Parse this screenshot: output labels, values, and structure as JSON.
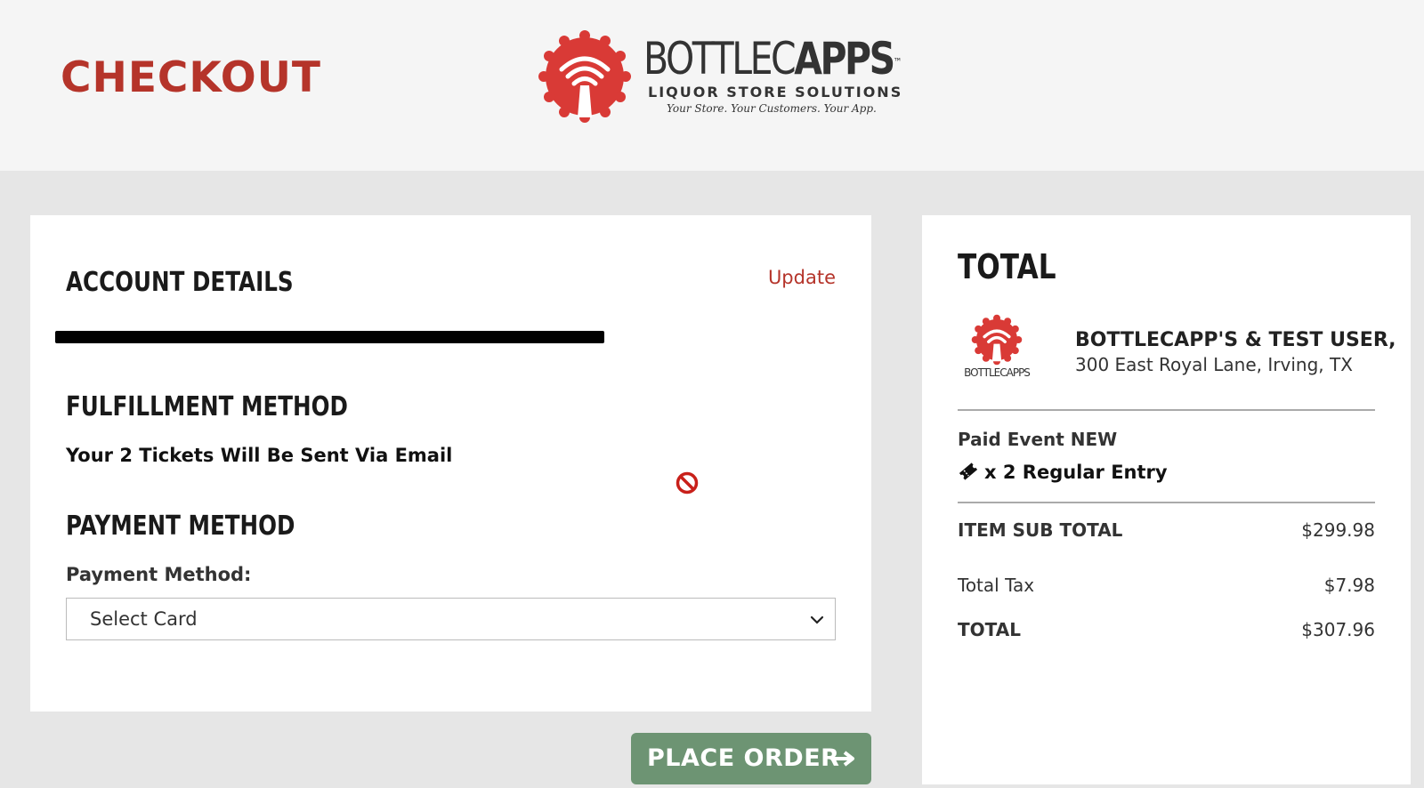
{
  "header": {
    "title": "CHECKOUT",
    "logo": {
      "name_light": "BOTTLEC",
      "name_bold": "APPS",
      "trademark": "™",
      "tagline": "LIQUOR STORE SOLUTIONS",
      "slogan": "Your Store. Your Customers. Your App."
    }
  },
  "account": {
    "title": "ACCOUNT DETAILS",
    "update_label": "Update"
  },
  "fulfillment": {
    "title": "FULFILLMENT METHOD",
    "text": "Your 2 Tickets Will Be Sent Via Email"
  },
  "payment": {
    "title": "PAYMENT METHOD",
    "label": "Payment Method:",
    "selected": "Select Card"
  },
  "place_order": {
    "label": "PLACE ORDER"
  },
  "summary": {
    "title": "TOTAL",
    "store_logo_text": "BOTTLECAPPS",
    "store_name": "BOTTLECAPP'S & TEST USER,",
    "store_address": "300 East Royal Lane, Irving, TX",
    "event_name": "Paid Event NEW",
    "ticket_line": "x 2 Regular Entry",
    "rows": [
      {
        "label": "ITEM SUB TOTAL",
        "value": "$299.98"
      },
      {
        "label": "Total Tax",
        "value": "$7.98"
      },
      {
        "label": "TOTAL",
        "value": "$307.96"
      }
    ]
  },
  "colors": {
    "brand_red": "#b5342a",
    "button_green": "#6d9473",
    "background": "#e6e6e6"
  }
}
